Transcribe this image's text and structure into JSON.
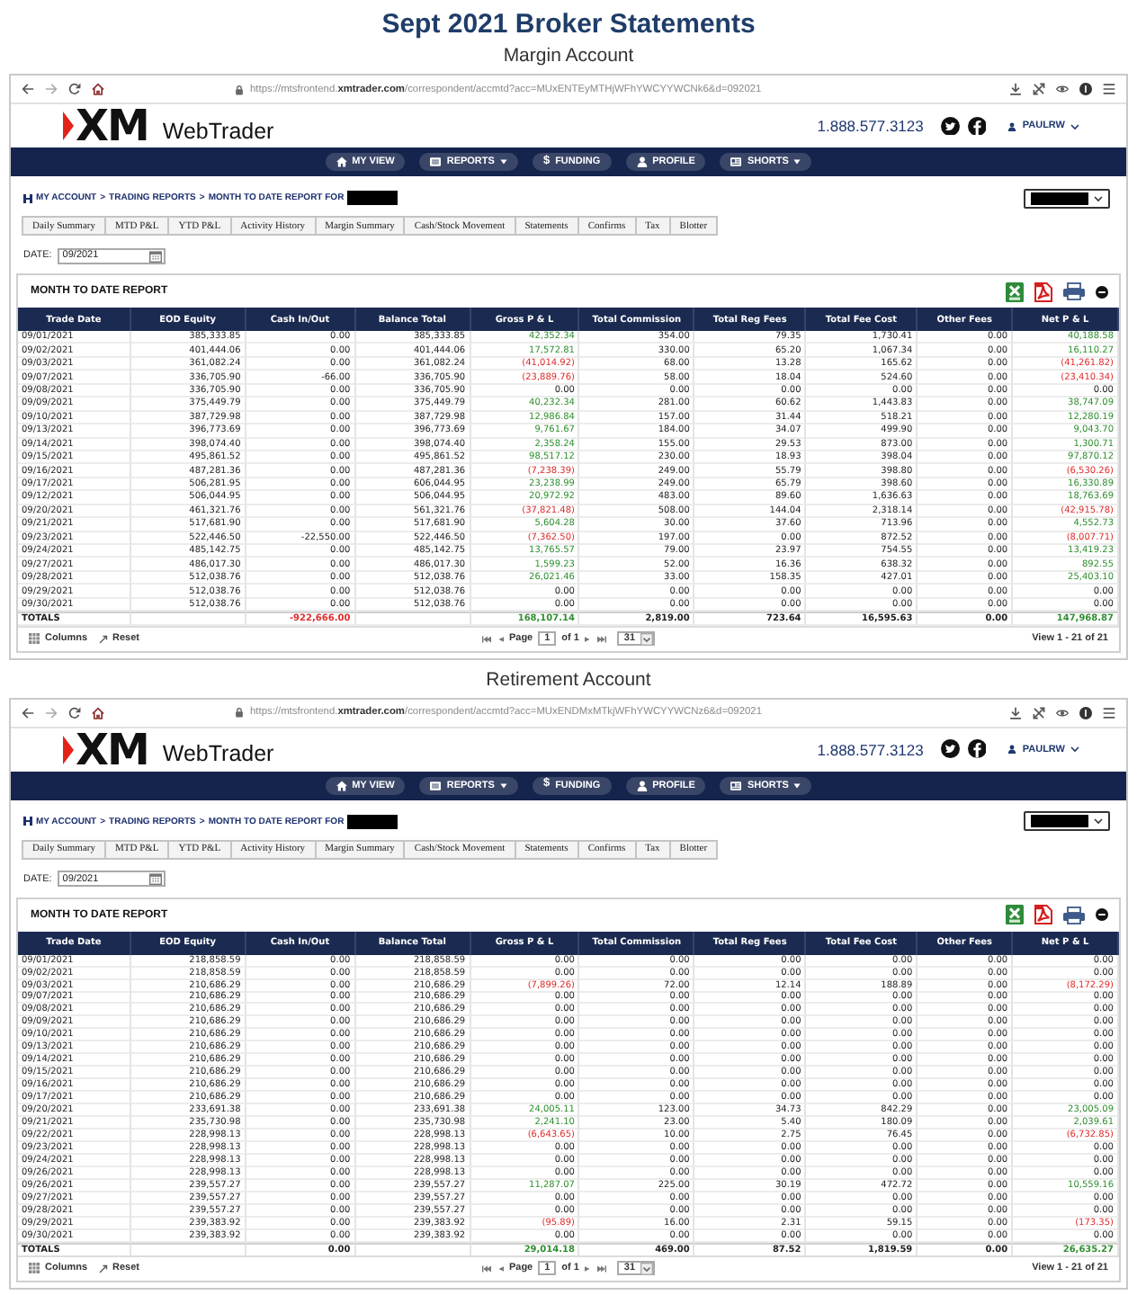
{
  "heading": {
    "title": "Sept 2021 Broker Statements"
  },
  "accounts": [
    {
      "caption": "Margin Account",
      "browser": {
        "url": "https://mtsfrontend.**xmtrader.com**/correspondent/accmtd?acc=MUxENTEyMTHjWFhYWCYYWCNk6&d=092021"
      },
      "site": {
        "logo": "XM",
        "product": "WebTrader",
        "phone": "1.888.577.3123",
        "user": "PAULRW"
      },
      "nav": [
        {
          "label": "MY VIEW",
          "kind": "home",
          "dropdown": false
        },
        {
          "label": "REPORTS",
          "kind": "list",
          "dropdown": true
        },
        {
          "label": "FUNDING",
          "kind": "symbol",
          "symbol": "$",
          "dropdown": false
        },
        {
          "label": "PROFILE",
          "kind": "user",
          "dropdown": false
        },
        {
          "label": "SHORTS",
          "kind": "card",
          "dropdown": true
        }
      ],
      "breadcrumb": {
        "links": [
          "MY ACCOUNT",
          "TRADING REPORTS",
          "MONTH TO DATE REPORT FOR"
        ],
        "separators": [
          ">",
          ">"
        ]
      },
      "tabs": [
        "Daily Summary",
        "MTD P&L",
        "YTD P&L",
        "Activity History",
        "Margin Summary",
        "Cash/Stock Movement",
        "Statements",
        "Confirms",
        "Tax",
        "Blotter"
      ],
      "date": {
        "label": "DATE:",
        "value": "09/2021"
      },
      "report": {
        "title": "MONTH TO DATE REPORT",
        "columns": [
          "Trade Date",
          "EOD Equity",
          "Cash In/Out",
          "Balance Total",
          "Gross P & L",
          "Total Commission",
          "Total Reg Fees",
          "Total Fee Cost",
          "Other Fees",
          "Net P & L"
        ],
        "rows": [
          [
            "09/01/2021",
            "385,333.85",
            "0.00",
            "385,333.85",
            {
              "text": "42,352.34",
              "color": "#2f8f2f"
            },
            "354.00",
            "79.35",
            "1,730.41",
            "0.00",
            {
              "text": "40,188.58",
              "color": "#2f8f2f"
            }
          ],
          [
            "09/02/2021",
            "401,444.06",
            "0.00",
            "401,444.06",
            {
              "text": "17,572.81",
              "color": "#2f8f2f"
            },
            "330.00",
            "65.20",
            "1,067.34",
            "0.00",
            {
              "text": "16,110.27",
              "color": "#2f8f2f"
            }
          ],
          [
            "09/03/2021",
            "361,082.24",
            "0.00",
            "361,082.24",
            {
              "text": "(41,014.92)",
              "color": "#e02b2b"
            },
            "68.00",
            "13.28",
            "165.62",
            "0.00",
            {
              "text": "(41,261.82)",
              "color": "#e02b2b"
            }
          ],
          [
            "09/07/2021",
            "336,705.90",
            "-66.00",
            "336,705.90",
            {
              "text": "(23,889.76)",
              "color": "#e02b2b"
            },
            "58.00",
            "18.04",
            "524.60",
            "0.00",
            {
              "text": "(23,410.34)",
              "color": "#e02b2b"
            }
          ],
          [
            "09/08/2021",
            "336,705.90",
            "0.00",
            "336,705.90",
            "0.00",
            "0.00",
            "0.00",
            "0.00",
            "0.00",
            "0.00"
          ],
          [
            "09/09/2021",
            "375,449.79",
            "0.00",
            "375,449.79",
            {
              "text": "40,232.34",
              "color": "#2f8f2f"
            },
            "281.00",
            "60.62",
            "1,443.83",
            "0.00",
            {
              "text": "38,747.09",
              "color": "#2f8f2f"
            }
          ],
          [
            "09/10/2021",
            "387,729.98",
            "0.00",
            "387,729.98",
            {
              "text": "12,986.84",
              "color": "#2f8f2f"
            },
            "157.00",
            "31.44",
            "518.21",
            "0.00",
            {
              "text": "12,280.19",
              "color": "#2f8f2f"
            }
          ],
          [
            "09/13/2021",
            "396,773.69",
            "0.00",
            "396,773.69",
            {
              "text": "9,761.67",
              "color": "#2f8f2f"
            },
            "184.00",
            "34.07",
            "499.90",
            "0.00",
            {
              "text": "9,043.70",
              "color": "#2f8f2f"
            }
          ],
          [
            "09/14/2021",
            "398,074.40",
            "0.00",
            "398,074.40",
            {
              "text": "2,358.24",
              "color": "#2f8f2f"
            },
            "155.00",
            "29.53",
            "873.00",
            "0.00",
            {
              "text": "1,300.71",
              "color": "#2f8f2f"
            }
          ],
          [
            "09/15/2021",
            "495,861.52",
            "0.00",
            "495,861.52",
            {
              "text": "98,517.12",
              "color": "#2f8f2f"
            },
            "230.00",
            "18.93",
            "398.04",
            "0.00",
            {
              "text": "97,870.12",
              "color": "#2f8f2f"
            }
          ],
          [
            "09/16/2021",
            "487,281.36",
            "0.00",
            "487,281.36",
            {
              "text": "(7,238.39)",
              "color": "#e02b2b"
            },
            "249.00",
            "55.79",
            "398.80",
            "0.00",
            {
              "text": "(6,530.26)",
              "color": "#e02b2b"
            }
          ],
          [
            "09/17/2021",
            "506,281.95",
            "0.00",
            "606,044.95",
            {
              "text": "23,238.99",
              "color": "#2f8f2f"
            },
            "249.00",
            "65.79",
            "398.60",
            "0.00",
            {
              "text": "16,330.89",
              "color": "#2f8f2f"
            }
          ],
          [
            "09/12/2021",
            "506,044.95",
            "0.00",
            "506,044.95",
            {
              "text": "20,972.92",
              "color": "#2f8f2f"
            },
            "483.00",
            "89.60",
            "1,636.63",
            "0.00",
            {
              "text": "18,763.69",
              "color": "#2f8f2f"
            }
          ],
          [
            "09/20/2021",
            "461,321.76",
            "0.00",
            "561,321.76",
            {
              "text": "(37,821.48)",
              "color": "#e02b2b"
            },
            "508.00",
            "144.04",
            "2,318.14",
            "0.00",
            {
              "text": "(42,915.78)",
              "color": "#e02b2b"
            }
          ],
          [
            "09/21/2021",
            "517,681.90",
            "0.00",
            "517,681.90",
            {
              "text": "5,604.28",
              "color": "#2f8f2f"
            },
            "30.00",
            "37.60",
            "713.96",
            "0.00",
            {
              "text": "4,552.73",
              "color": "#2f8f2f"
            }
          ],
          [
            "09/23/2021",
            "522,446.50",
            "-22,550.00",
            "522,446.50",
            {
              "text": "(7,362.50)",
              "color": "#e02b2b"
            },
            "197.00",
            "0.00",
            "872.52",
            "0.00",
            {
              "text": "(8,007.71)",
              "color": "#e02b2b"
            }
          ],
          [
            "09/24/2021",
            "485,142.75",
            "0.00",
            "485,142.75",
            {
              "text": "13,765.57",
              "color": "#2f8f2f"
            },
            "79.00",
            "23.97",
            "754.55",
            "0.00",
            {
              "text": "13,419.23",
              "color": "#2f8f2f"
            }
          ],
          [
            "09/27/2021",
            "486,017.30",
            "0.00",
            "486,017.30",
            {
              "text": "1,599.23",
              "color": "#2f8f2f"
            },
            "52.00",
            "16.36",
            "638.32",
            "0.00",
            {
              "text": "892.55",
              "color": "#2f8f2f"
            }
          ],
          [
            "09/28/2021",
            "512,038.76",
            "0.00",
            "512,038.76",
            {
              "text": "26,021.46",
              "color": "#2f8f2f"
            },
            "33.00",
            "158.35",
            "427.01",
            "0.00",
            {
              "text": "25,403.10",
              "color": "#2f8f2f"
            }
          ],
          [
            "09/29/2021",
            "512,038.76",
            "0.00",
            "512,038.76",
            "0.00",
            "0.00",
            "0.00",
            "0.00",
            "0.00",
            "0.00"
          ],
          [
            "09/30/2021",
            "512,038.76",
            "0.00",
            "512,038.76",
            "0.00",
            "0.00",
            "0.00",
            "0.00",
            "0.00",
            "0.00"
          ]
        ],
        "totals": {
          "trade_date": "TOTALS",
          "cash_in_out": {
            "text": "-922,666.00",
            "color": "#e02b2b"
          },
          "gross_pl": {
            "text": "168,107.14",
            "color": "#2f8f2f"
          },
          "total_commission": "2,819.00",
          "total_reg_fees": "723.64",
          "total_fee_cost": "16,595.63",
          "other_fees": "0.00",
          "net_pl": {
            "text": "147,968.87",
            "color": "#2f8f2f"
          }
        },
        "footer": {
          "columns_button": "Columns",
          "reset_button": "Reset",
          "page_label": "Page",
          "page": "1",
          "page_total": "of 1",
          "page_size": "31",
          "view_range": "View 1 - 21 of 21"
        }
      }
    },
    {
      "caption": "Retirement Account",
      "browser": {
        "url": "https://mtsfrontend.**xmtrader.com**/correspondent/accmtd?acc=MUxENDMxMTkjWFhYWCYYWCNz6&d=092021"
      },
      "site": {
        "logo": "XM",
        "product": "WebTrader",
        "phone": "1.888.577.3123",
        "user": "PAULRW"
      },
      "nav": [
        {
          "label": "MY VIEW",
          "kind": "home",
          "dropdown": false
        },
        {
          "label": "REPORTS",
          "kind": "list",
          "dropdown": true
        },
        {
          "label": "FUNDING",
          "kind": "symbol",
          "symbol": "$",
          "dropdown": false
        },
        {
          "label": "PROFILE",
          "kind": "user",
          "dropdown": false
        },
        {
          "label": "SHORTS",
          "kind": "card",
          "dropdown": true
        }
      ],
      "breadcrumb": {
        "links": [
          "MY ACCOUNT",
          "TRADING REPORTS",
          "MONTH TO DATE REPORT FOR"
        ],
        "separators": [
          ">",
          ">"
        ]
      },
      "tabs": [
        "Daily Summary",
        "MTD P&L",
        "YTD P&L",
        "Activity History",
        "Margin Summary",
        "Cash/Stock Movement",
        "Statements",
        "Confirms",
        "Tax",
        "Blotter"
      ],
      "date": {
        "label": "DATE:",
        "value": "09/2021"
      },
      "report": {
        "title": "MONTH TO DATE REPORT",
        "columns": [
          "Trade Date",
          "EOD Equity",
          "Cash In/Out",
          "Balance Total",
          "Gross P & L",
          "Total Commission",
          "Total Reg Fees",
          "Total Fee Cost",
          "Other Fees",
          "Net P & L"
        ],
        "rows": [
          [
            "09/01/2021",
            "218,858.59",
            "0.00",
            "218,858.59",
            "0.00",
            "0.00",
            "0.00",
            "0.00",
            "0.00",
            "0.00"
          ],
          [
            "09/02/2021",
            "218,858.59",
            "0.00",
            "218,858.59",
            "0.00",
            "0.00",
            "0.00",
            "0.00",
            "0.00",
            "0.00"
          ],
          [
            "09/03/2021",
            "210,686.29",
            "0.00",
            "210,686.29",
            {
              "text": "(7,899.26)",
              "color": "#e02b2b"
            },
            "72.00",
            "12.14",
            "188.89",
            "0.00",
            {
              "text": "(8,172.29)",
              "color": "#e02b2b"
            }
          ],
          [
            "09/07/2021",
            "210,686.29",
            "0.00",
            "210,686.29",
            "0.00",
            "0.00",
            "0.00",
            "0.00",
            "0.00",
            "0.00"
          ],
          [
            "09/08/2021",
            "210,686.29",
            "0.00",
            "210,686.29",
            "0.00",
            "0.00",
            "0.00",
            "0.00",
            "0.00",
            "0.00"
          ],
          [
            "09/09/2021",
            "210,686.29",
            "0.00",
            "210,686.29",
            "0.00",
            "0.00",
            "0.00",
            "0.00",
            "0.00",
            "0.00"
          ],
          [
            "09/10/2021",
            "210,686.29",
            "0.00",
            "210,686.29",
            "0.00",
            "0.00",
            "0.00",
            "0.00",
            "0.00",
            "0.00"
          ],
          [
            "09/13/2021",
            "210,686.29",
            "0.00",
            "210,686.29",
            "0.00",
            "0.00",
            "0.00",
            "0.00",
            "0.00",
            "0.00"
          ],
          [
            "09/14/2021",
            "210,686.29",
            "0.00",
            "210,686.29",
            "0.00",
            "0.00",
            "0.00",
            "0.00",
            "0.00",
            "0.00"
          ],
          [
            "09/15/2021",
            "210,686.29",
            "0.00",
            "210,686.29",
            "0.00",
            "0.00",
            "0.00",
            "0.00",
            "0.00",
            "0.00"
          ],
          [
            "09/16/2021",
            "210,686.29",
            "0.00",
            "210,686.29",
            "0.00",
            "0.00",
            "0.00",
            "0.00",
            "0.00",
            "0.00"
          ],
          [
            "09/17/2021",
            "210,686.29",
            "0.00",
            "210,686.29",
            "0.00",
            "0.00",
            "0.00",
            "0.00",
            "0.00",
            "0.00"
          ],
          [
            "09/20/2021",
            "233,691.38",
            "0.00",
            "233,691.38",
            {
              "text": "24,005.11",
              "color": "#2f8f2f"
            },
            "123.00",
            "34.73",
            "842.29",
            "0.00",
            {
              "text": "23,005.09",
              "color": "#2f8f2f"
            }
          ],
          [
            "09/21/2021",
            "235,730.98",
            "0.00",
            "235,730.98",
            {
              "text": "2,241.10",
              "color": "#2f8f2f"
            },
            "23.00",
            "5.40",
            "180.09",
            "0.00",
            {
              "text": "2,039.61",
              "color": "#2f8f2f"
            }
          ],
          [
            "09/22/2021",
            "228,998.13",
            "0.00",
            "228,998.13",
            {
              "text": "(6,643.65)",
              "color": "#e02b2b"
            },
            "10.00",
            "2.75",
            "76.45",
            "0.00",
            {
              "text": "(6,732.85)",
              "color": "#e02b2b"
            }
          ],
          [
            "09/23/2021",
            "228,998.13",
            "0.00",
            "228,998.13",
            "0.00",
            "0.00",
            "0.00",
            "0.00",
            "0.00",
            "0.00"
          ],
          [
            "09/24/2021",
            "228,998.13",
            "0.00",
            "228,998.13",
            "0.00",
            "0.00",
            "0.00",
            "0.00",
            "0.00",
            "0.00"
          ],
          [
            "09/26/2021",
            "228,998.13",
            "0.00",
            "228,998.13",
            "0.00",
            "0.00",
            "0.00",
            "0.00",
            "0.00",
            "0.00"
          ],
          [
            "09/26/2021",
            "239,557.27",
            "0.00",
            "239,557.27",
            {
              "text": "11,287.07",
              "color": "#2f8f2f"
            },
            "225.00",
            "30.19",
            "472.72",
            "0.00",
            {
              "text": "10,559.16",
              "color": "#2f8f2f"
            }
          ],
          [
            "09/27/2021",
            "239,557.27",
            "0.00",
            "239,557.27",
            "0.00",
            "0.00",
            "0.00",
            "0.00",
            "0.00",
            "0.00"
          ],
          [
            "09/28/2021",
            "239,557.27",
            "0.00",
            "239,557.27",
            "0.00",
            "0.00",
            "0.00",
            "0.00",
            "0.00",
            "0.00"
          ],
          [
            "09/29/2021",
            "239,383.92",
            "0.00",
            "239,383.92",
            {
              "text": "(95.89)",
              "color": "#e02b2b"
            },
            "16.00",
            "2.31",
            "59.15",
            "0.00",
            {
              "text": "(173.35)",
              "color": "#e02b2b"
            }
          ],
          [
            "09/30/2021",
            "239,383.92",
            "0.00",
            "239,383.92",
            "0.00",
            "0.00",
            "0.00",
            "0.00",
            "0.00",
            "0.00"
          ]
        ],
        "totals": {
          "trade_date": "TOTALS",
          "cash_in_out": "0.00",
          "gross_pl": {
            "text": "29,014.18",
            "color": "#2f8f2f"
          },
          "total_commission": "469.00",
          "total_reg_fees": "87.52",
          "total_fee_cost": "1,819.59",
          "other_fees": "0.00",
          "net_pl": {
            "text": "26,635.27",
            "color": "#2f8f2f"
          }
        },
        "footer": {
          "columns_button": "Columns",
          "reset_button": "Reset",
          "page_label": "Page",
          "page": "1",
          "page_total": "of 1",
          "page_size": "31",
          "view_range": "View 1 - 21 of 21"
        }
      }
    }
  ]
}
